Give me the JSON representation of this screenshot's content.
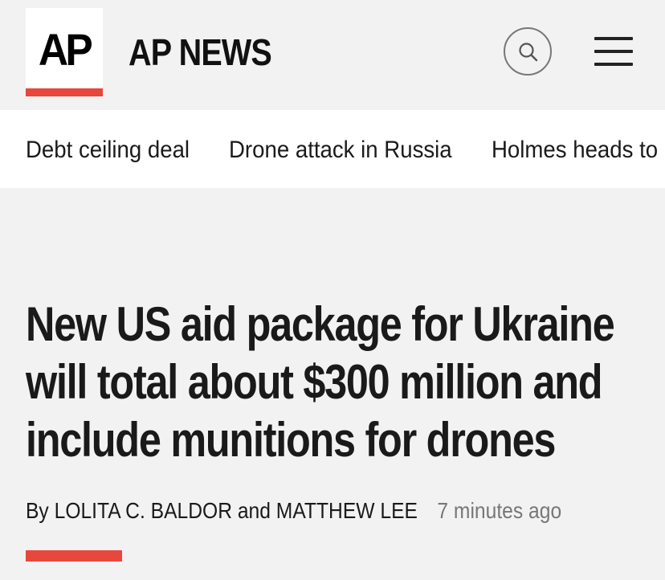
{
  "header": {
    "logo_text": "AP",
    "site_title": "AP NEWS",
    "search_icon": "search-icon",
    "menu_icon": "hamburger-menu-icon"
  },
  "trending": {
    "items": [
      {
        "label": "Debt ceiling deal"
      },
      {
        "label": "Drone attack in Russia"
      },
      {
        "label": "Holmes heads to"
      }
    ]
  },
  "article": {
    "headline": "New US aid package for Ukraine will total about $300 million and include munitions for drones",
    "byline_prefix": "By",
    "author_1": "LOLITA C. BALDOR",
    "byline_conjunction": "and",
    "author_2": "MATTHEW LEE",
    "timestamp": "7 minutes ago"
  },
  "colors": {
    "accent": "#e8473c",
    "background": "#f2f2f2",
    "text": "#1a1a1a",
    "muted": "#777777"
  }
}
